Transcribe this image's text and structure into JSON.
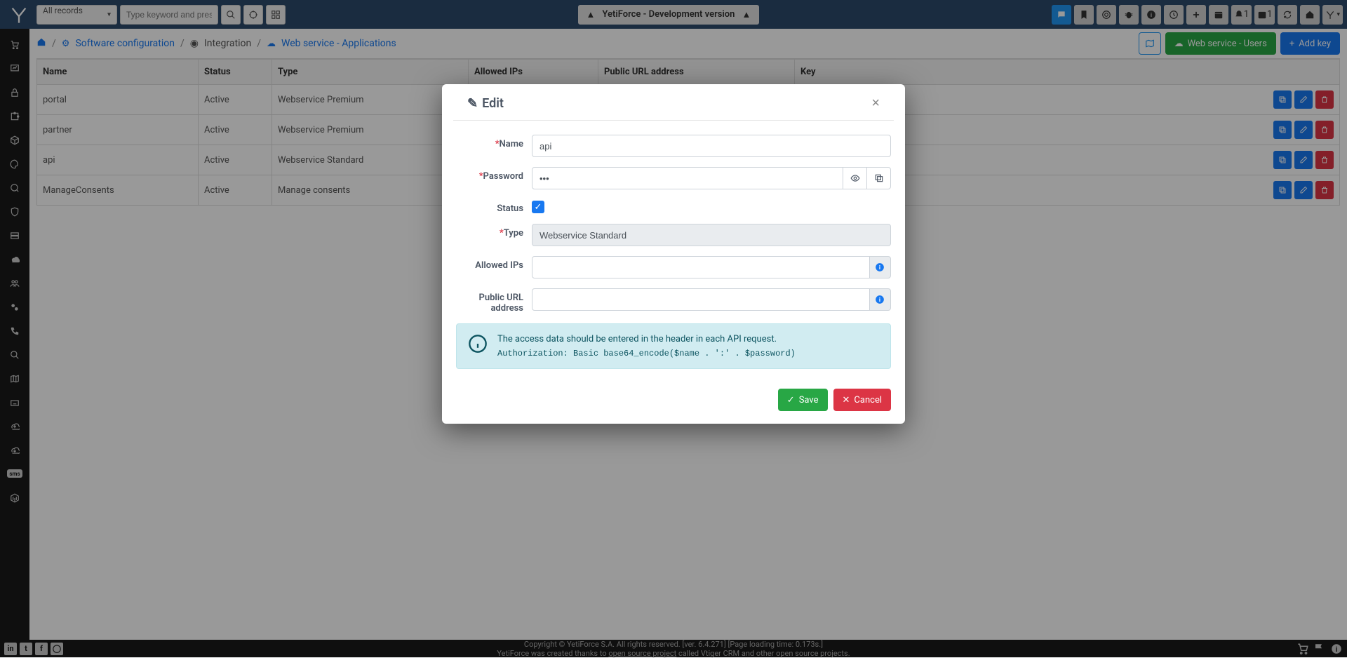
{
  "navbar": {
    "records_selector": "All records",
    "search_placeholder": "Type keyword and press enter",
    "center_text": "YetiForce - Development version",
    "notif_count": "1",
    "cal_count": "1"
  },
  "breadcrumb": {
    "config": "Software configuration",
    "integration": "Integration",
    "current": "Web service - Applications"
  },
  "page_actions": {
    "users": "Web service - Users",
    "add_key": "Add key"
  },
  "table": {
    "headers": {
      "name": "Name",
      "status": "Status",
      "type": "Type",
      "ips": "Allowed IPs",
      "url": "Public URL address",
      "key": "Key"
    },
    "rows": [
      {
        "name": "portal",
        "status": "Active",
        "type": "Webservice Premium",
        "ips": "",
        "url": "",
        "key": "************************"
      },
      {
        "name": "partner",
        "status": "Active",
        "type": "Webservice Premium",
        "ips": "",
        "url": "",
        "key": "************************"
      },
      {
        "name": "api",
        "status": "Active",
        "type": "Webservice Standard",
        "ips": "",
        "url": "",
        "key": "************************"
      },
      {
        "name": "ManageConsents",
        "status": "Active",
        "type": "Manage consents",
        "ips": "",
        "url": "",
        "key": "************************"
      }
    ]
  },
  "modal": {
    "title": "Edit",
    "labels": {
      "name": "Name",
      "password": "Password",
      "status": "Status",
      "type": "Type",
      "ips": "Allowed IPs",
      "url": "Public URL address"
    },
    "values": {
      "name": "api",
      "password": "•••",
      "type": "Webservice Standard",
      "status_checked": true
    },
    "info_text": "The access data should be entered in the header in each API request.",
    "info_code": "Authorization: Basic base64_encode($name . ':' . $password)",
    "buttons": {
      "save": "Save",
      "cancel": "Cancel"
    }
  },
  "footer": {
    "line1": "Copyright © YetiForce S.A. All rights reserved. [ver. 6.4.271] [Page loading time: 0.173s.]",
    "line2a": "YetiForce was created thanks to ",
    "line2link": "open source project",
    "line2b": " called Vtiger CRM and other open source projects."
  }
}
